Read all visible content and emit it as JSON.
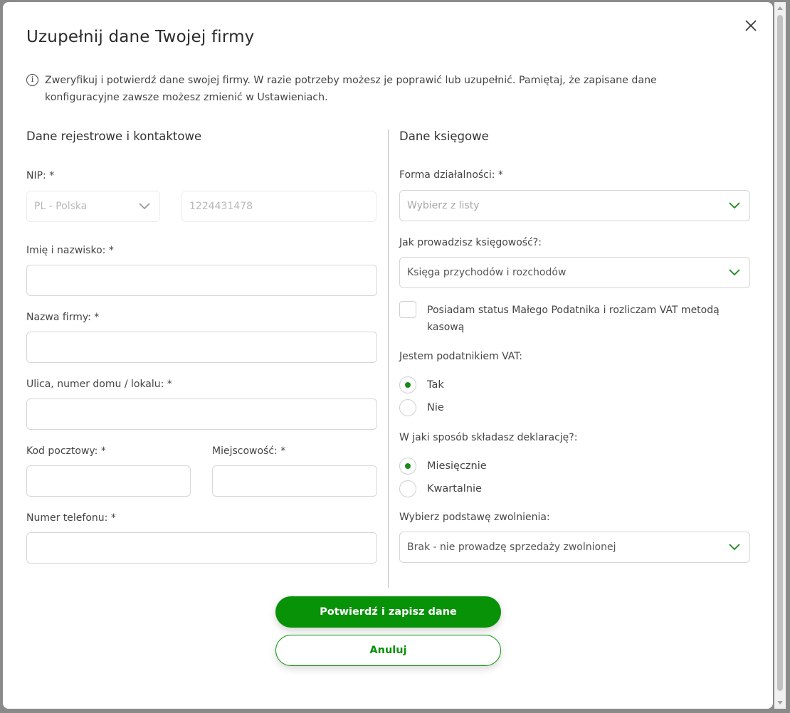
{
  "dialog": {
    "title": "Uzupełnij dane Twojej firmy",
    "info": "Zweryfikuj i potwierdź dane swojej firmy. W razie potrzeby możesz je poprawić lub uzupełnić. Pamiętaj, że zapisane dane konfiguracyjne zawsze możesz zmienić w Ustawieniach."
  },
  "left": {
    "section_title": "Dane rejestrowe i kontaktowe",
    "nip_label": "NIP: *",
    "country_value": "PL - Polska",
    "nip_value": "1224431478",
    "name_label": "Imię i nazwisko: *",
    "company_label": "Nazwa firmy: *",
    "street_label": "Ulica, numer domu / lokalu: *",
    "postal_label": "Kod pocztowy: *",
    "city_label": "Miejscowość: *",
    "phone_label": "Numer telefonu: *"
  },
  "right": {
    "section_title": "Dane księgowe",
    "form_label": "Forma działalności: *",
    "form_placeholder": "Wybierz z listy",
    "accounting_label": "Jak prowadzisz księgowość?:",
    "accounting_value": "Księga przychodów i rozchodów",
    "small_taxpayer_label": "Posiadam status Małego Podatnika i rozliczam VAT metodą kasową",
    "vat_label": "Jestem podatnikiem VAT:",
    "vat_yes": "Tak",
    "vat_no": "Nie",
    "declaration_label": "W jaki sposób składasz deklarację?:",
    "decl_monthly": "Miesięcznie",
    "decl_quarterly": "Kwartalnie",
    "exemption_label": "Wybierz podstawę zwolnienia:",
    "exemption_value": "Brak - nie prowadzę sprzedaży zwolnionej"
  },
  "buttons": {
    "confirm": "Potwierdź i zapisz dane",
    "cancel": "Anuluj"
  },
  "icons": {
    "close": "close-icon",
    "info": "info-icon",
    "chevron": "chevron-down-icon"
  },
  "colors": {
    "accent": "#079207",
    "chevron_green": "#1a8a1a",
    "chevron_gray": "#9a9a9a"
  }
}
